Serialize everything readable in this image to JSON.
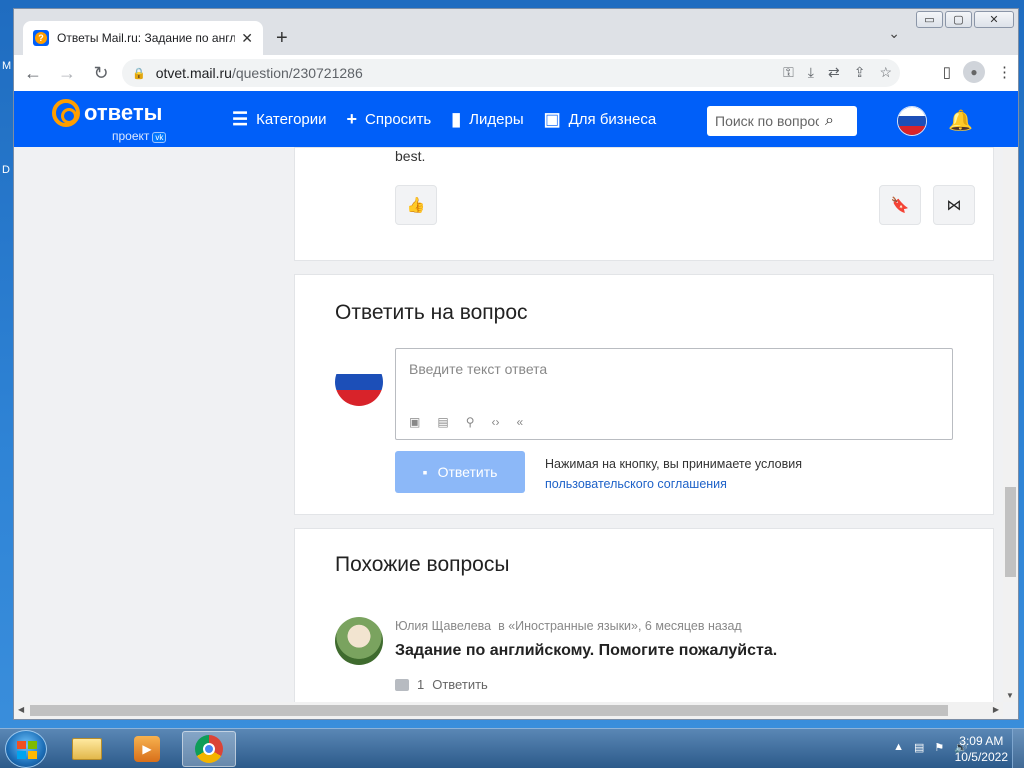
{
  "browser": {
    "tab_title": "Ответы Mail.ru: Задание по англ",
    "tab_close": "✕",
    "new_tab": "+",
    "url_host": "otvet.mail.ru",
    "url_path": "/question/230721286",
    "window_controls": [
      "▭",
      "▢",
      "✕"
    ]
  },
  "site": {
    "logo_text": "ответы",
    "logo_sub": "проект",
    "logo_badge": "vk",
    "nav": [
      {
        "label": "Категории",
        "icon": "list-icon"
      },
      {
        "label": "Спросить",
        "icon": "plus-icon"
      },
      {
        "label": "Лидеры",
        "icon": "bar-chart-icon"
      },
      {
        "label": "Для бизнеса",
        "icon": "briefcase-icon"
      }
    ],
    "search_placeholder": "Поиск по вопросам"
  },
  "answer_card": {
    "trailing_text": "best."
  },
  "reply": {
    "heading": "Ответить на вопрос",
    "placeholder": "Введите текст ответа",
    "submit_label": "Ответить",
    "terms_text": "Нажимая на кнопку, вы принимаете условия",
    "terms_link": "пользовательского соглашения"
  },
  "similar": {
    "heading": "Похожие вопросы",
    "items": [
      {
        "author": "Юлия Щавелева",
        "category": "в «Иностранные языки», 6 месяцев назад",
        "title": "Задание по английскому. Помогите пожалуйста.",
        "answers_count": "1",
        "answer_label": "Ответить"
      }
    ]
  },
  "taskbar": {
    "time": "3:09 AM",
    "date": "10/5/2022"
  },
  "desktop": {
    "letters": [
      "M",
      "D"
    ]
  }
}
